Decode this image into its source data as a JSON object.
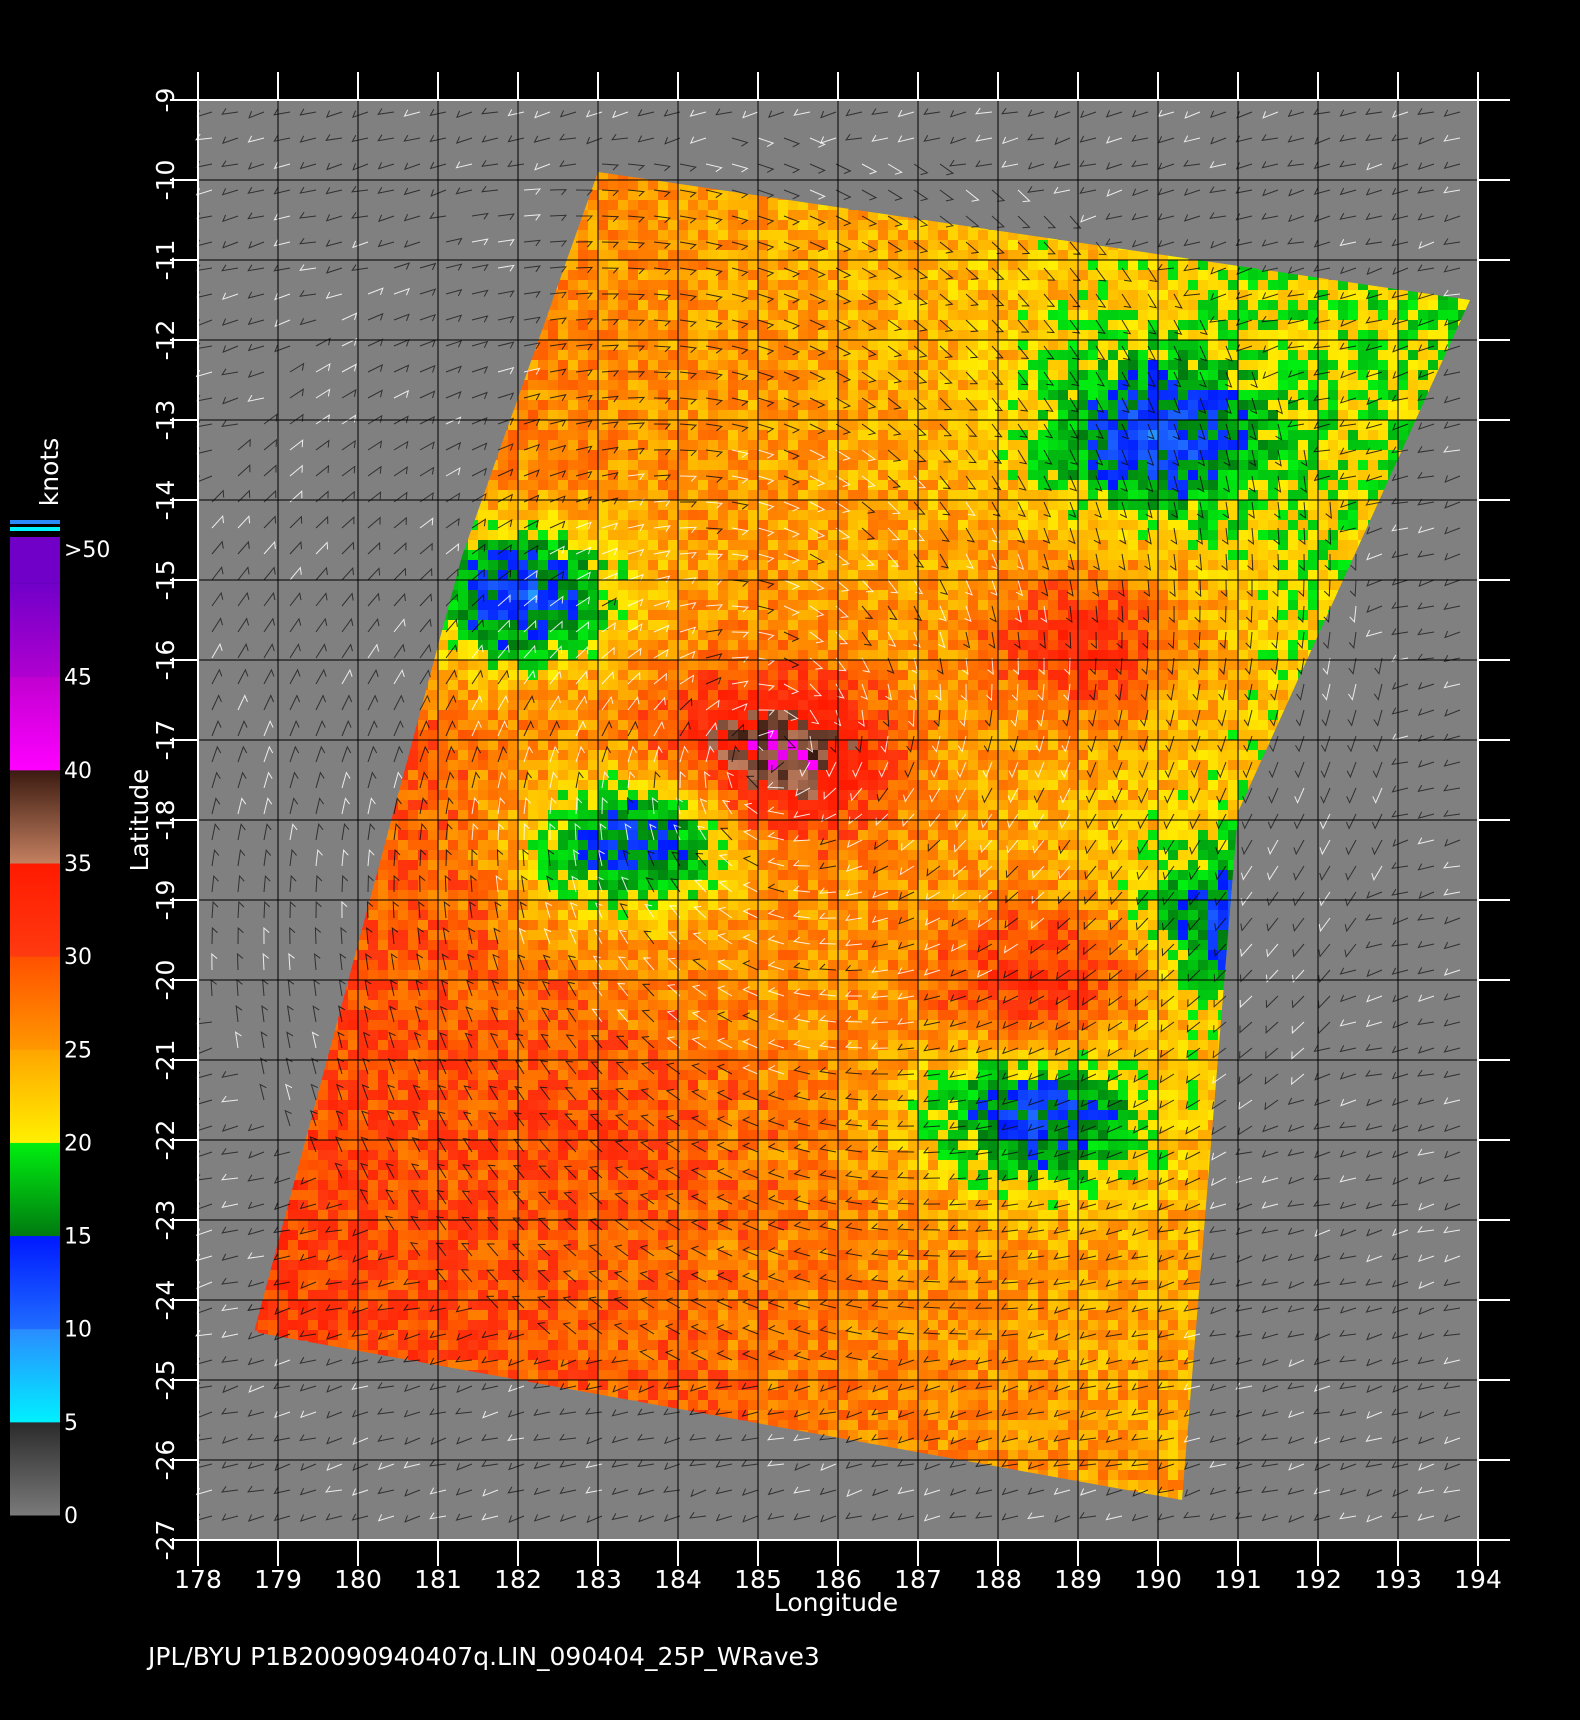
{
  "chart_data": {
    "type": "heatmap",
    "xlabel": "Longitude",
    "ylabel": "Latitude",
    "xlim": [
      178,
      194
    ],
    "ylim": [
      -27,
      -9
    ],
    "x_ticks": [
      "178",
      "179",
      "180",
      "181",
      "182",
      "183",
      "184",
      "185",
      "186",
      "187",
      "188",
      "189",
      "190",
      "191",
      "192",
      "193",
      "194"
    ],
    "y_ticks": [
      "-9",
      "-10",
      "-11",
      "-12",
      "-13",
      "-14",
      "-15",
      "-16",
      "-17",
      "-18",
      "-19",
      "-20",
      "-21",
      "-22",
      "-23",
      "-24",
      "-25",
      "-26",
      "-27"
    ],
    "grid": true,
    "colorbar": {
      "title": "knots",
      "tick_labels": [
        "0",
        "5",
        "10",
        "15",
        "20",
        "25",
        "30",
        "35",
        "40",
        "45",
        ">50"
      ],
      "bands": [
        {
          "from": 0,
          "to": 5,
          "colors": [
            "#7a7a7a",
            "#2a2a2a"
          ]
        },
        {
          "from": 5,
          "to": 10,
          "colors": [
            "#00f0ff",
            "#2a8bff"
          ]
        },
        {
          "from": 10,
          "to": 15,
          "colors": [
            "#1f6dff",
            "#0018ff"
          ]
        },
        {
          "from": 15,
          "to": 20,
          "colors": [
            "#007a10",
            "#00f010"
          ]
        },
        {
          "from": 20,
          "to": 25,
          "colors": [
            "#fff000",
            "#ffa500"
          ]
        },
        {
          "from": 25,
          "to": 30,
          "colors": [
            "#ff9800",
            "#ff5000"
          ]
        },
        {
          "from": 30,
          "to": 35,
          "colors": [
            "#ff3a10",
            "#ff1a00"
          ]
        },
        {
          "from": 35,
          "to": 40,
          "colors": [
            "#c48060",
            "#3a1a10"
          ]
        },
        {
          "from": 40,
          "to": 45,
          "colors": [
            "#ff00ff",
            "#c000d0"
          ]
        },
        {
          "from": 45,
          "to": 50,
          "colors": [
            "#b000d0",
            "#7000c8"
          ]
        }
      ]
    },
    "swath_corners_lonlat": [
      [
        183.0,
        -9.9
      ],
      [
        193.9,
        -11.5
      ],
      [
        191.0,
        -17.9
      ],
      [
        190.3,
        -26.5
      ],
      [
        178.7,
        -24.4
      ],
      [
        181.3,
        -14.7
      ]
    ],
    "wind_field_features": [
      {
        "name": "cyclone core",
        "center": [
          185.2,
          -17.2
        ],
        "speed_knots": 40
      },
      {
        "name": "calm region",
        "center": [
          190.0,
          -13.2
        ],
        "speed_knots": 12
      },
      {
        "name": "calm band",
        "center": [
          188.5,
          -21.6
        ],
        "speed_knots": 12
      },
      {
        "name": "calm patch",
        "center": [
          191.1,
          -19.3
        ],
        "speed_knots": 12
      },
      {
        "name": "calm patch",
        "center": [
          182.0,
          -15.2
        ],
        "speed_knots": 12
      },
      {
        "name": "calm patch",
        "center": [
          183.4,
          -18.3
        ],
        "speed_knots": 14
      },
      {
        "name": "strong band",
        "center": [
          189.0,
          -15.8
        ],
        "speed_knots": 32
      },
      {
        "name": "strong band",
        "center": [
          183.0,
          -22.0
        ],
        "speed_knots": 30
      },
      {
        "name": "strong band",
        "center": [
          188.5,
          -20.0
        ],
        "speed_knots": 32
      }
    ],
    "background_color": "#808080"
  },
  "caption": "JPL/BYU  P1B20090940407q.LIN_090404_25P_WRave3"
}
